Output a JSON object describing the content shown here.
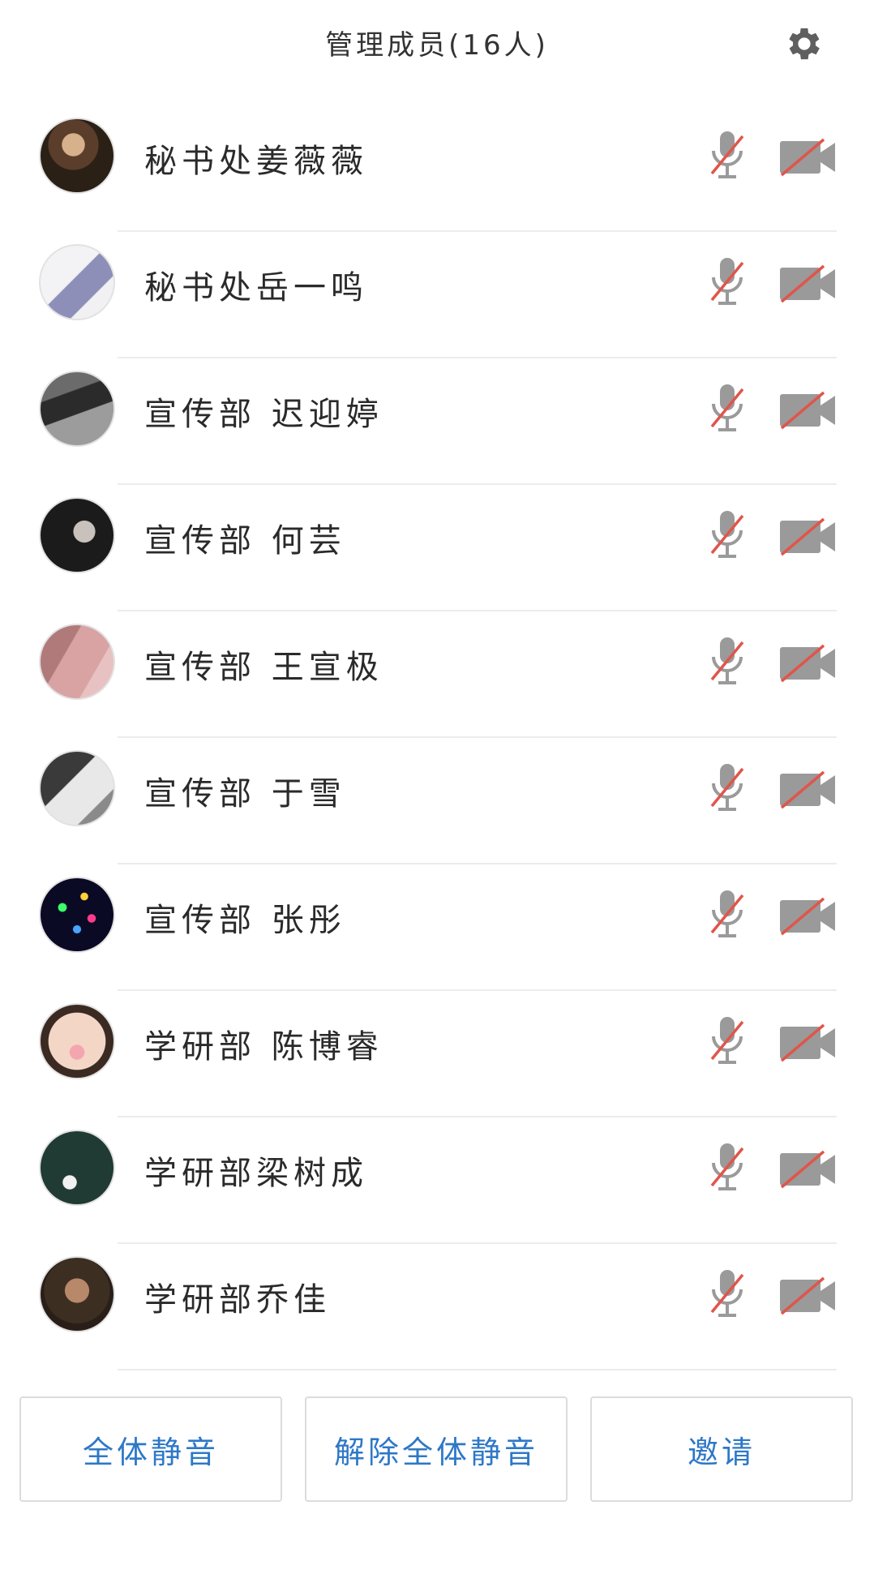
{
  "header": {
    "title": "管理成员(16人)",
    "settings_icon": "gear-icon"
  },
  "colors": {
    "accent": "#2e78c7",
    "muted_icon": "#9a9a9a",
    "strike": "#e0554b"
  },
  "members": [
    {
      "name": "秘书处姜薇薇"
    },
    {
      "name": "秘书处岳一鸣"
    },
    {
      "name": "宣传部 迟迎婷"
    },
    {
      "name": "宣传部 何芸"
    },
    {
      "name": "宣传部 王宣极"
    },
    {
      "name": "宣传部 于雪"
    },
    {
      "name": "宣传部 张彤"
    },
    {
      "name": "学研部 陈博睿"
    },
    {
      "name": "学研部梁树成"
    },
    {
      "name": "学研部乔佳"
    }
  ],
  "actions": {
    "mute_all": "全体静音",
    "unmute_all": "解除全体静音",
    "invite": "邀请"
  }
}
